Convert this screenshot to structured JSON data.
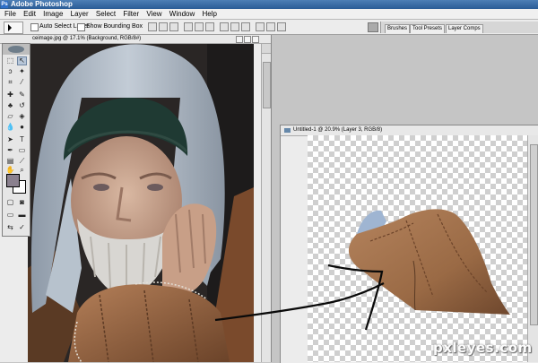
{
  "app": {
    "title": "Adobe Photoshop",
    "logo_icon": "photoshop-logo-icon"
  },
  "menu": [
    "File",
    "Edit",
    "Image",
    "Layer",
    "Select",
    "Filter",
    "View",
    "Window",
    "Help"
  ],
  "options_bar": {
    "auto_select_label": "Auto Select Layer",
    "auto_select_checked": false,
    "bounding_box_label": "Show Bounding Box",
    "bounding_box_checked": false
  },
  "palette_well": {
    "tabs": [
      "Brushes",
      "Tool Presets",
      "Layer Comps"
    ]
  },
  "document1": {
    "title": "ceimage.jpg @ 17.1% (Background, RGB/8#)"
  },
  "document2": {
    "title": "Untitled-1 @ 20.9% (Layer 3, RGB/8)"
  },
  "toolbox": {
    "foreground_color": "#8a808e",
    "background_color": "#ffffff"
  },
  "watermark": {
    "text": "pxleyes.com"
  },
  "colors": {
    "title_bar": "#2a5c96",
    "hood": "#a7b3c0",
    "beanie": "#1f3a33",
    "jacket": "#9a6a45",
    "skin": "#c49f88",
    "beard": "#d8d6d2"
  }
}
